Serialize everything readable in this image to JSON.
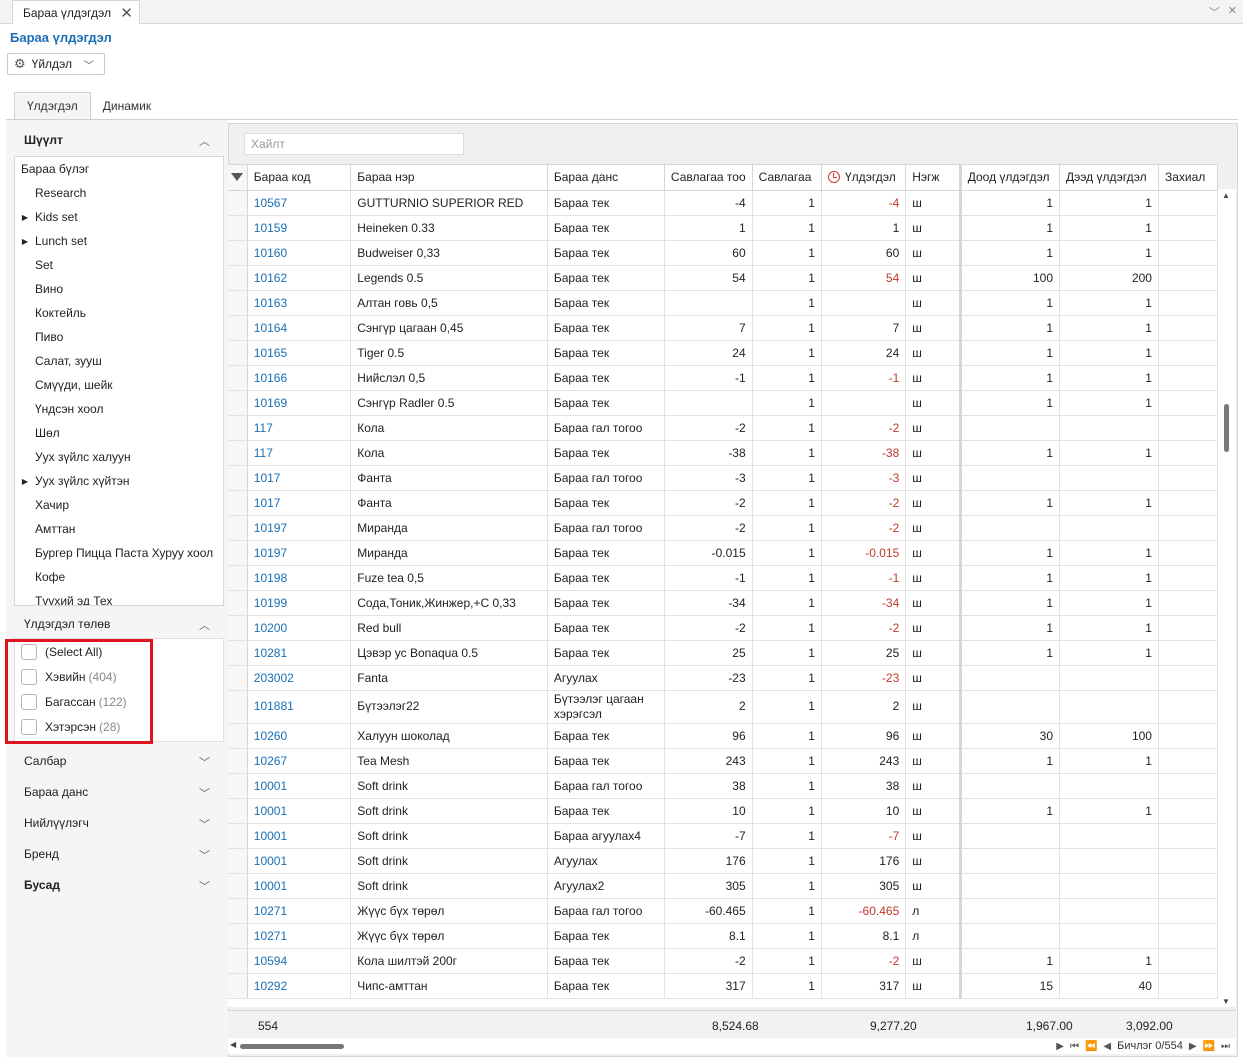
{
  "doc_tab": {
    "label": "Бараа үлдэгдэл",
    "close": "✕"
  },
  "page_title": "Бараа үлдэгдэл",
  "action_button": {
    "label": "Үйлдэл"
  },
  "tabs": [
    {
      "label": "Үлдэгдэл"
    },
    {
      "label": "Динамик"
    }
  ],
  "sidebar": {
    "group_title": "Шүүлт",
    "tree_root": "Бараа бүлэг",
    "tree_items": [
      {
        "label": "Research",
        "arrow": ""
      },
      {
        "label": "Kids set",
        "arrow": "▶"
      },
      {
        "label": "Lunch set",
        "arrow": "▶"
      },
      {
        "label": "Set",
        "arrow": ""
      },
      {
        "label": "Вино",
        "arrow": ""
      },
      {
        "label": "Коктейль",
        "arrow": ""
      },
      {
        "label": "Пиво",
        "arrow": ""
      },
      {
        "label": "Салат, зууш",
        "arrow": ""
      },
      {
        "label": "Смүүди, шейк",
        "arrow": ""
      },
      {
        "label": "Үндсэн хоол",
        "arrow": ""
      },
      {
        "label": "Шөл",
        "arrow": ""
      },
      {
        "label": "Ууx зүйлс халуун",
        "arrow": ""
      },
      {
        "label": "Ууx зүйлс хүйтэн",
        "arrow": "▶"
      },
      {
        "label": "Хачир",
        "arrow": ""
      },
      {
        "label": "Амттан",
        "arrow": ""
      },
      {
        "label": "Бургер Пицца Паста Хуруу хоол",
        "arrow": ""
      },
      {
        "label": "Кофе",
        "arrow": ""
      },
      {
        "label": "Түүхий эд Тех",
        "arrow": ""
      }
    ],
    "status_title": "Үлдэгдэл төлөв",
    "status_items": [
      {
        "label": "(Select All)",
        "count": ""
      },
      {
        "label": "Хэвийн",
        "count": "(404)"
      },
      {
        "label": "Багассан",
        "count": "(122)"
      },
      {
        "label": "Хэтэрсэн",
        "count": "(28)"
      }
    ],
    "sections": [
      {
        "label": "Салбар",
        "bold": false
      },
      {
        "label": "Бараа данс",
        "bold": false
      },
      {
        "label": "Нийлүүлэгч",
        "bold": false
      },
      {
        "label": "Бренд",
        "bold": false
      },
      {
        "label": "Бусад",
        "bold": true
      }
    ]
  },
  "search": {
    "placeholder": "Хайлт"
  },
  "columns": [
    "Бараа код",
    "Бараа нэр",
    "Бараа данс",
    "Савлагаа тоо",
    "Савлагаа",
    "Үлдэгдэл",
    "Нэгж",
    "Доод үлдэгдэл",
    "Дээд үлдэгдэл",
    "Захиал"
  ],
  "rows": [
    {
      "code": "10567",
      "name": "GUTTURNIO SUPERIOR RED",
      "account": "Бараа тек",
      "pack_qty": "-4",
      "pack": "1",
      "balance": "-4",
      "neg": true,
      "unit": "ш",
      "min": "1",
      "max": "1"
    },
    {
      "code": "10159",
      "name": "Heineken 0.33",
      "account": "Бараа тек",
      "pack_qty": "1",
      "pack": "1",
      "balance": "1",
      "neg": false,
      "unit": "ш",
      "min": "1",
      "max": "1"
    },
    {
      "code": "10160",
      "name": "Budweiser 0,33",
      "account": "Бараа тек",
      "pack_qty": "60",
      "pack": "1",
      "balance": "60",
      "neg": false,
      "unit": "ш",
      "min": "1",
      "max": "1"
    },
    {
      "code": "10162",
      "name": "Legends 0.5",
      "account": "Бараа тек",
      "pack_qty": "54",
      "pack": "1",
      "balance": "54",
      "neg": true,
      "unit": "ш",
      "min": "100",
      "max": "200"
    },
    {
      "code": "10163",
      "name": "Алтан говь 0,5",
      "account": "Бараа тек",
      "pack_qty": "",
      "pack": "1",
      "balance": "",
      "neg": false,
      "unit": "ш",
      "min": "1",
      "max": "1"
    },
    {
      "code": "10164",
      "name": "Сэнгүр цагаан 0,45",
      "account": "Бараа тек",
      "pack_qty": "7",
      "pack": "1",
      "balance": "7",
      "neg": false,
      "unit": "ш",
      "min": "1",
      "max": "1"
    },
    {
      "code": "10165",
      "name": "Tiger 0.5",
      "account": "Бараа тек",
      "pack_qty": "24",
      "pack": "1",
      "balance": "24",
      "neg": false,
      "unit": "ш",
      "min": "1",
      "max": "1"
    },
    {
      "code": "10166",
      "name": "Нийслэл 0,5",
      "account": "Бараа тек",
      "pack_qty": "-1",
      "pack": "1",
      "balance": "-1",
      "neg": true,
      "unit": "ш",
      "min": "1",
      "max": "1"
    },
    {
      "code": "10169",
      "name": "Сэнгүр Radler 0.5",
      "account": "Бараа тек",
      "pack_qty": "",
      "pack": "1",
      "balance": "",
      "neg": false,
      "unit": "ш",
      "min": "1",
      "max": "1"
    },
    {
      "code": "117",
      "name": "Кола",
      "account": "Бараа гал тогоо",
      "pack_qty": "-2",
      "pack": "1",
      "balance": "-2",
      "neg": true,
      "unit": "ш",
      "min": "",
      "max": ""
    },
    {
      "code": "117",
      "name": "Кола",
      "account": "Бараа тек",
      "pack_qty": "-38",
      "pack": "1",
      "balance": "-38",
      "neg": true,
      "unit": "ш",
      "min": "1",
      "max": "1"
    },
    {
      "code": "1017",
      "name": "Фанта",
      "account": "Бараа гал тогоо",
      "pack_qty": "-3",
      "pack": "1",
      "balance": "-3",
      "neg": true,
      "unit": "ш",
      "min": "",
      "max": ""
    },
    {
      "code": "1017",
      "name": "Фанта",
      "account": "Бараа тек",
      "pack_qty": "-2",
      "pack": "1",
      "balance": "-2",
      "neg": true,
      "unit": "ш",
      "min": "1",
      "max": "1"
    },
    {
      "code": "10197",
      "name": "Миранда",
      "account": "Бараа гал тогоо",
      "pack_qty": "-2",
      "pack": "1",
      "balance": "-2",
      "neg": true,
      "unit": "ш",
      "min": "",
      "max": ""
    },
    {
      "code": "10197",
      "name": "Миранда",
      "account": "Бараа тек",
      "pack_qty": "-0.015",
      "pack": "1",
      "balance": "-0.015",
      "neg": true,
      "unit": "ш",
      "min": "1",
      "max": "1"
    },
    {
      "code": "10198",
      "name": "Fuze tea 0,5",
      "account": "Бараа тек",
      "pack_qty": "-1",
      "pack": "1",
      "balance": "-1",
      "neg": true,
      "unit": "ш",
      "min": "1",
      "max": "1"
    },
    {
      "code": "10199",
      "name": "Сода,Тоник,Жинжер,+С 0,33",
      "account": "Бараа тек",
      "pack_qty": "-34",
      "pack": "1",
      "balance": "-34",
      "neg": true,
      "unit": "ш",
      "min": "1",
      "max": "1"
    },
    {
      "code": "10200",
      "name": "Red bull",
      "account": "Бараа тек",
      "pack_qty": "-2",
      "pack": "1",
      "balance": "-2",
      "neg": true,
      "unit": "ш",
      "min": "1",
      "max": "1"
    },
    {
      "code": "10281",
      "name": "Цэвэр ус Bonaqua 0.5",
      "account": "Бараа тек",
      "pack_qty": "25",
      "pack": "1",
      "balance": "25",
      "neg": false,
      "unit": "ш",
      "min": "1",
      "max": "1"
    },
    {
      "code": "203002",
      "name": "Fanta",
      "account": "Агуулах",
      "pack_qty": "-23",
      "pack": "1",
      "balance": "-23",
      "neg": true,
      "unit": "ш",
      "min": "",
      "max": ""
    },
    {
      "code": "101881",
      "name": "Бүтээлэг22",
      "account": "Бүтээлэг цагаан хэрэгсэл",
      "pack_qty": "2",
      "pack": "1",
      "balance": "2",
      "neg": false,
      "unit": "ш",
      "min": "",
      "max": "",
      "tall": true
    },
    {
      "code": "10260",
      "name": "Халуун шоколад",
      "account": "Бараа тек",
      "pack_qty": "96",
      "pack": "1",
      "balance": "96",
      "neg": false,
      "unit": "ш",
      "min": "30",
      "max": "100"
    },
    {
      "code": "10267",
      "name": "Tea Mesh",
      "account": "Бараа тек",
      "pack_qty": "243",
      "pack": "1",
      "balance": "243",
      "neg": false,
      "unit": "ш",
      "min": "1",
      "max": "1"
    },
    {
      "code": "10001",
      "name": "Soft drink",
      "account": "Бараа гал тогоо",
      "pack_qty": "38",
      "pack": "1",
      "balance": "38",
      "neg": false,
      "unit": "ш",
      "min": "",
      "max": ""
    },
    {
      "code": "10001",
      "name": "Soft drink",
      "account": "Бараа тек",
      "pack_qty": "10",
      "pack": "1",
      "balance": "10",
      "neg": false,
      "unit": "ш",
      "min": "1",
      "max": "1"
    },
    {
      "code": "10001",
      "name": "Soft drink",
      "account": "Бараа агуулах4",
      "pack_qty": "-7",
      "pack": "1",
      "balance": "-7",
      "neg": true,
      "unit": "ш",
      "min": "",
      "max": ""
    },
    {
      "code": "10001",
      "name": "Soft drink",
      "account": "Агуулах",
      "pack_qty": "176",
      "pack": "1",
      "balance": "176",
      "neg": false,
      "unit": "ш",
      "min": "",
      "max": ""
    },
    {
      "code": "10001",
      "name": "Soft drink",
      "account": "Агуулах2",
      "pack_qty": "305",
      "pack": "1",
      "balance": "305",
      "neg": false,
      "unit": "ш",
      "min": "",
      "max": ""
    },
    {
      "code": "10271",
      "name": "Жүүс бүх төрөл",
      "account": "Бараа гал тогоо",
      "pack_qty": "-60.465",
      "pack": "1",
      "balance": "-60.465",
      "neg": true,
      "unit": "л",
      "min": "",
      "max": ""
    },
    {
      "code": "10271",
      "name": "Жүүс бүх төрөл",
      "account": "Бараа тек",
      "pack_qty": "8.1",
      "pack": "1",
      "balance": "8.1",
      "neg": false,
      "unit": "л",
      "min": "",
      "max": ""
    },
    {
      "code": "10594",
      "name": "Кола шилтэй 200г",
      "account": "Бараа тек",
      "pack_qty": "-2",
      "pack": "1",
      "balance": "-2",
      "neg": true,
      "unit": "ш",
      "min": "1",
      "max": "1"
    },
    {
      "code": "10292",
      "name": "Чипс-амттан",
      "account": "Бараа тек",
      "pack_qty": "317",
      "pack": "1",
      "balance": "317",
      "neg": false,
      "unit": "ш",
      "min": "15",
      "max": "40"
    }
  ],
  "footer": {
    "count": "554",
    "pack_qty_total": "8,524.68",
    "balance_total": "9,277.20",
    "min_total": "1,967.00",
    "max_total": "3,092.00"
  },
  "pager": {
    "label": "Бичлэг 0/554"
  },
  "colors": {
    "accent": "#1a6fb5",
    "negative": "#c0392b",
    "highlight": "#e0141e"
  }
}
